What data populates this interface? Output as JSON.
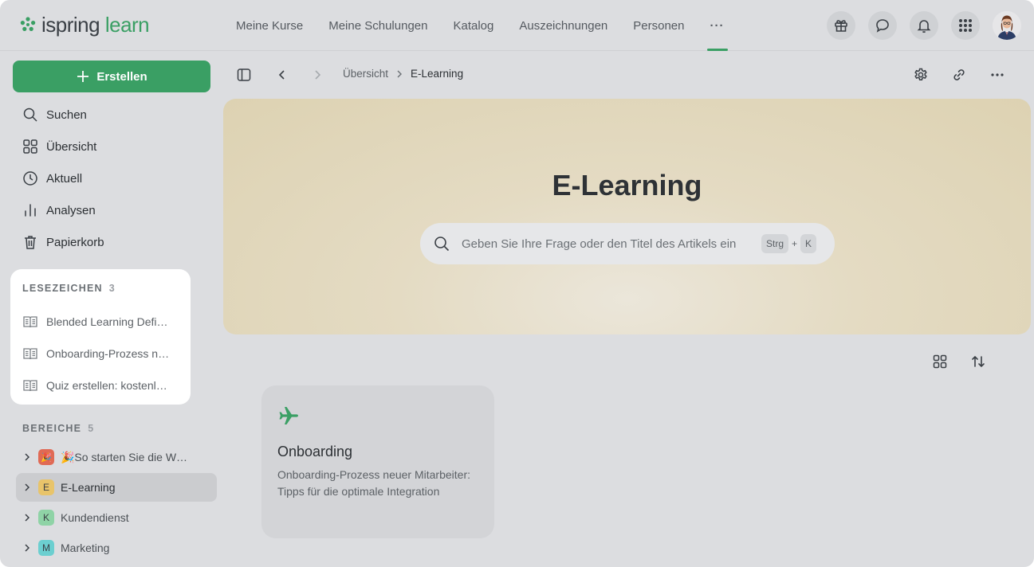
{
  "brand": {
    "part1": "ispring",
    "part2": "learn",
    "color": "#3a9f64"
  },
  "topnav": {
    "items": [
      {
        "label": "Meine Kurse"
      },
      {
        "label": "Meine Schulungen"
      },
      {
        "label": "Katalog"
      },
      {
        "label": "Auszeichnungen"
      },
      {
        "label": "Personen"
      }
    ],
    "more_label": "···",
    "actions": [
      "gift-icon",
      "chat-icon",
      "bell-icon",
      "apps-grid-icon",
      "user-avatar"
    ]
  },
  "sidebar": {
    "create_label": "Erstellen",
    "nav": [
      {
        "label": "Suchen",
        "icon": "search-icon"
      },
      {
        "label": "Übersicht",
        "icon": "grid-icon"
      },
      {
        "label": "Aktuell",
        "icon": "clock-icon"
      },
      {
        "label": "Analysen",
        "icon": "chart-icon"
      },
      {
        "label": "Papierkorb",
        "icon": "trash-icon"
      }
    ],
    "bookmarks": {
      "title": "LESEZEICHEN",
      "count": "3",
      "items": [
        {
          "label": "Blended Learning Definition"
        },
        {
          "label": "Onboarding-Prozess neuer Mitarbeiter"
        },
        {
          "label": "Quiz erstellen: kostenlose Tools"
        }
      ]
    },
    "areas": {
      "title": "BEREICHE",
      "count": "5",
      "items": [
        {
          "badge": "🎉",
          "label": "🎉So starten Sie die Wissensdatenbank",
          "color": "#e06a55"
        },
        {
          "badge": "E",
          "label": "E-Learning",
          "color": "#e8c46a",
          "active": true
        },
        {
          "badge": "K",
          "label": "Kundendienst",
          "color": "#8fd3a6"
        },
        {
          "badge": "M",
          "label": "Marketing",
          "color": "#6ccfd0"
        }
      ]
    }
  },
  "breadcrumb": {
    "parent": "Übersicht",
    "current": "E-Learning"
  },
  "hero": {
    "title": "E-Learning",
    "search_placeholder": "Geben Sie Ihre Frage oder den Titel des Artikels ein",
    "shortcut_key1": "Strg",
    "shortcut_plus": "+",
    "shortcut_key2": "K"
  },
  "cards": [
    {
      "icon": "airplane-icon",
      "title": "Onboarding",
      "description": "Onboarding-Prozess neuer Mitarbeiter: Tipps für die optimale Integration"
    }
  ]
}
